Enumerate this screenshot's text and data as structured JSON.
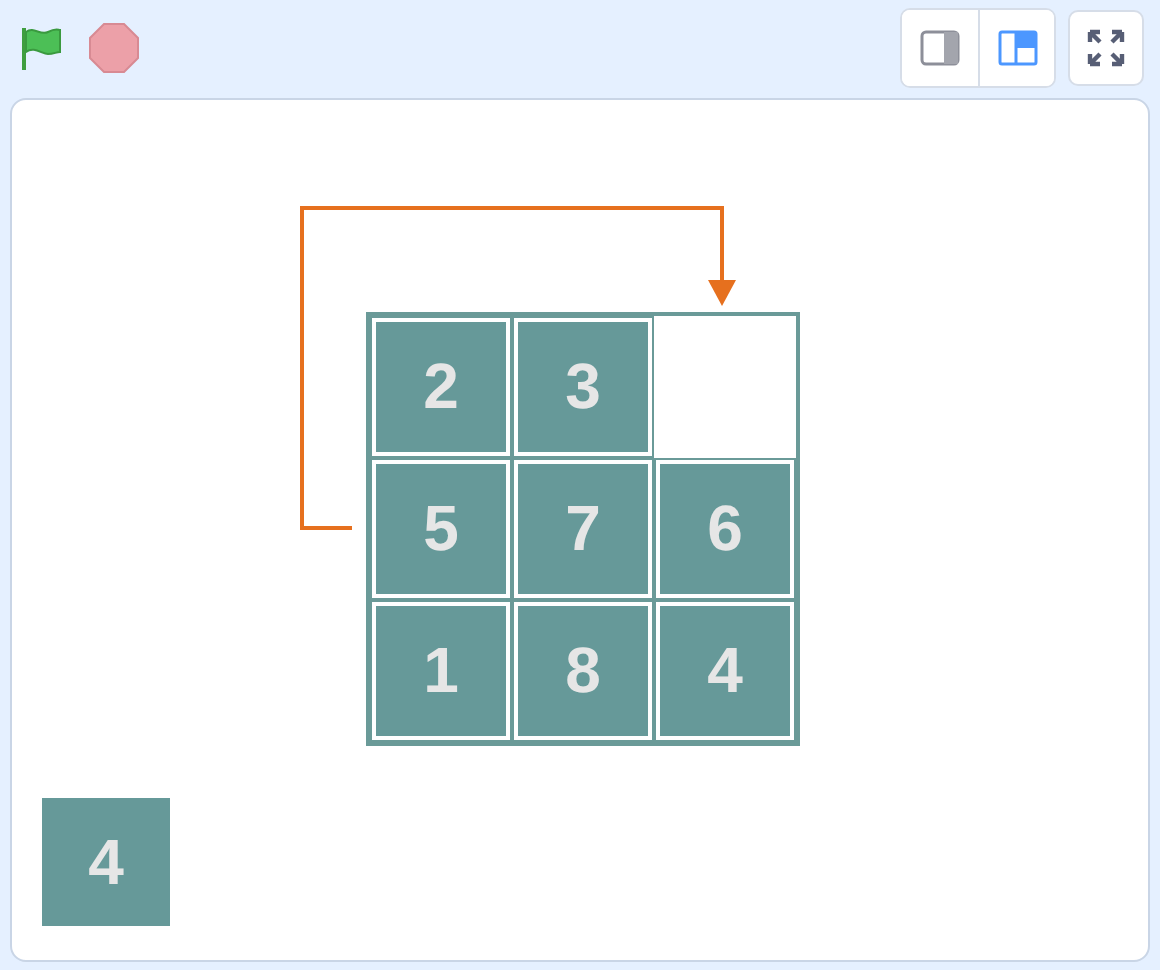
{
  "toolbar": {
    "layout_buttons": [
      {
        "kind": "small",
        "selected": false
      },
      {
        "kind": "normal",
        "selected": true
      }
    ]
  },
  "stage": {
    "board": [
      {
        "kind": "tile",
        "label": "2"
      },
      {
        "kind": "tile",
        "label": "3"
      },
      {
        "kind": "empty"
      },
      {
        "kind": "tile",
        "label": "5"
      },
      {
        "kind": "tile",
        "label": "7"
      },
      {
        "kind": "tile",
        "label": "6"
      },
      {
        "kind": "tile",
        "label": "1"
      },
      {
        "kind": "tile",
        "label": "8"
      },
      {
        "kind": "tile",
        "label": "4"
      }
    ],
    "loose_tile": {
      "label": "4"
    }
  }
}
